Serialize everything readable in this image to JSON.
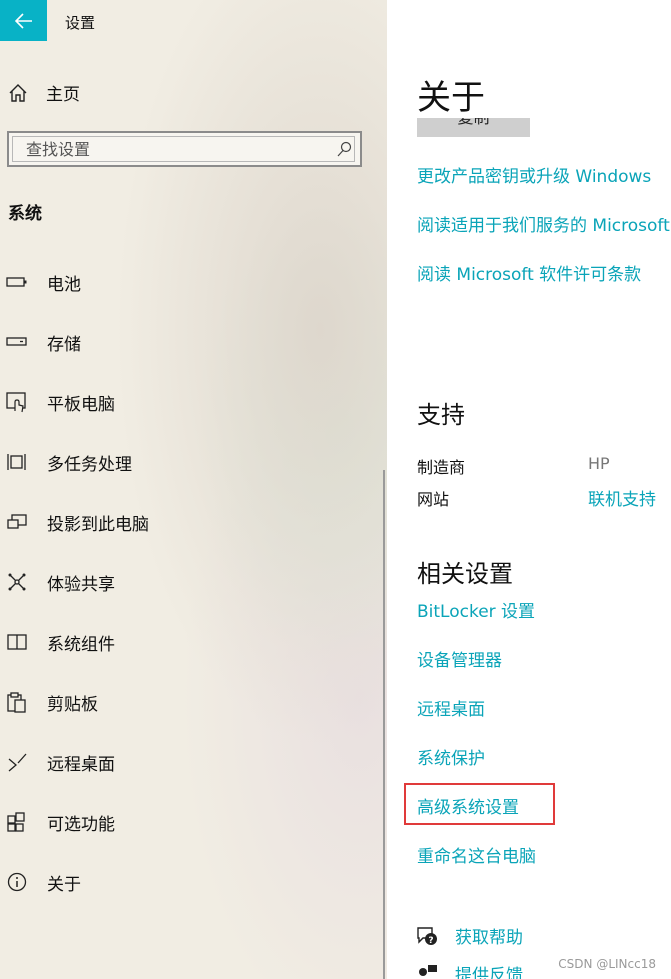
{
  "app": {
    "title": "设置"
  },
  "nav": {
    "home_label": "主页",
    "search_placeholder": "查找设置",
    "section_title": "系统",
    "items": [
      {
        "label": "电池",
        "icon": "battery-icon"
      },
      {
        "label": "存储",
        "icon": "storage-icon"
      },
      {
        "label": "平板电脑",
        "icon": "tablet-icon"
      },
      {
        "label": "多任务处理",
        "icon": "multitasking-icon"
      },
      {
        "label": "投影到此电脑",
        "icon": "projecting-icon"
      },
      {
        "label": "体验共享",
        "icon": "shared-experiences-icon"
      },
      {
        "label": "系统组件",
        "icon": "system-components-icon"
      },
      {
        "label": "剪贴板",
        "icon": "clipboard-icon"
      },
      {
        "label": "远程桌面",
        "icon": "remote-desktop-icon"
      },
      {
        "label": "可选功能",
        "icon": "optional-features-icon"
      },
      {
        "label": "关于",
        "icon": "info-icon"
      }
    ]
  },
  "content": {
    "title": "关于",
    "copy_button_label": "复制",
    "links_top": [
      "更改产品密钥或升级 Windows",
      "阅读适用于我们服务的 Microsoft 服务协议",
      "阅读 Microsoft 软件许可条款"
    ],
    "support": {
      "title": "支持",
      "manufacturer_label": "制造商",
      "manufacturer_value": "HP",
      "website_label": "网站",
      "website_link": "联机支持"
    },
    "related": {
      "title": "相关设置",
      "links": [
        "BitLocker 设置",
        "设备管理器",
        "远程桌面",
        "系统保护",
        "高级系统设置",
        "重命名这台电脑"
      ]
    },
    "help": {
      "get_help": "获取帮助",
      "feedback": "提供反馈"
    }
  },
  "watermark": "CSDN @LINcc18",
  "colors": {
    "accent": "#08b2c6",
    "link": "#0aa4b8",
    "highlight": "#e03a3a"
  }
}
